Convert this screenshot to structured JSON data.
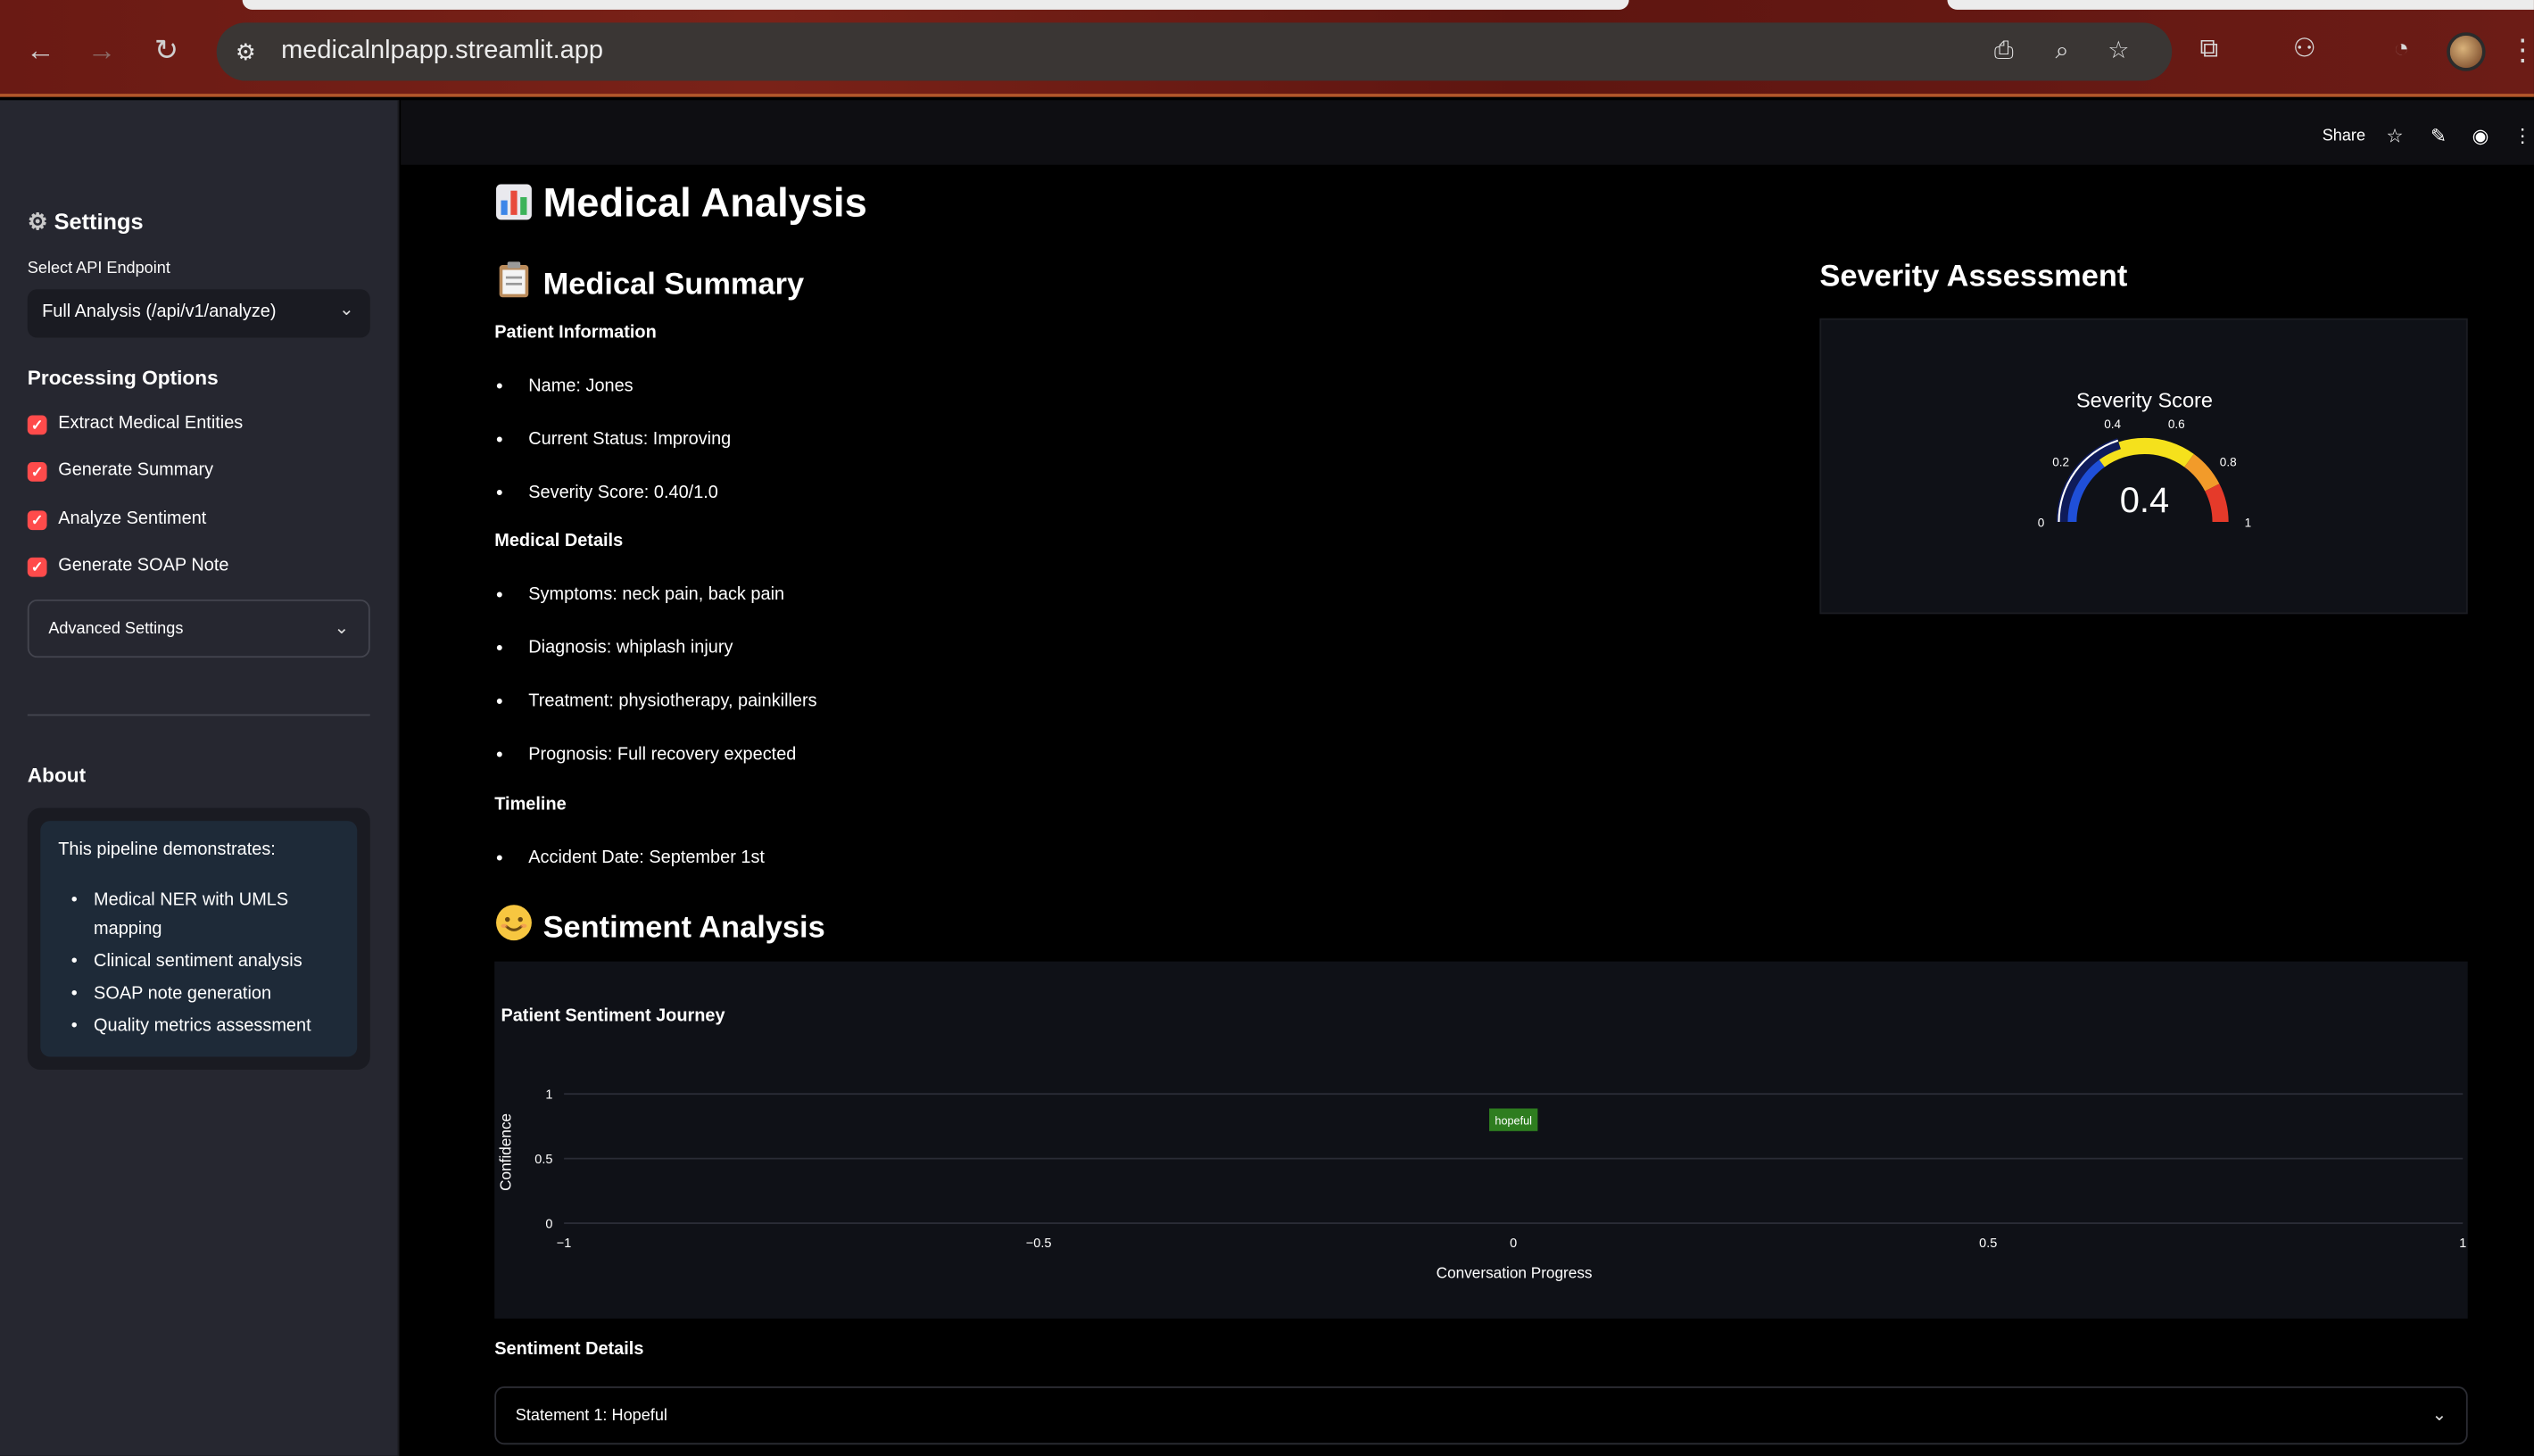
{
  "browser": {
    "url": "medicalnlpapp.streamlit.app"
  },
  "toolbar": {
    "share_label": "Share"
  },
  "sidebar": {
    "settings_title": "Settings",
    "endpoint_label": "Select API Endpoint",
    "endpoint_value": "Full Analysis (/api/v1/analyze)",
    "processing_title": "Processing Options",
    "options": [
      {
        "label": "Extract Medical Entities",
        "checked": true
      },
      {
        "label": "Generate Summary",
        "checked": true
      },
      {
        "label": "Analyze Sentiment",
        "checked": true
      },
      {
        "label": "Generate SOAP Note",
        "checked": true
      }
    ],
    "advanced_label": "Advanced Settings",
    "about_title": "About",
    "about_intro": "This pipeline demonstrates:",
    "about_items": [
      "Medical NER with UMLS mapping",
      "Clinical sentiment analysis",
      "SOAP note generation",
      "Quality metrics assessment"
    ]
  },
  "main": {
    "title": "Medical Analysis",
    "summary_title": "Medical Summary",
    "patient_info_title": "Patient Information",
    "patient_info": [
      "Name: Jones",
      "Current Status: Improving",
      "Severity Score: 0.40/1.0"
    ],
    "medical_details_title": "Medical Details",
    "medical_details": [
      "Symptoms: neck pain, back pain",
      "Diagnosis: whiplash injury",
      "Treatment: physiotherapy, painkillers",
      "Prognosis: Full recovery expected"
    ],
    "timeline_title": "Timeline",
    "timeline": [
      "Accident Date: September 1st"
    ],
    "severity_title": "Severity Assessment",
    "sentiment_title": "Sentiment Analysis",
    "sentiment_details_title": "Sentiment Details",
    "statement_label": "Statement 1: Hopeful"
  },
  "chart_data": [
    {
      "type": "gauge",
      "title": "Severity Score",
      "value": 0.4,
      "value_label": "0.4",
      "range": [
        0,
        1
      ],
      "ticks": [
        "0",
        "0.2",
        "0.4",
        "0.6",
        "0.8",
        "1"
      ],
      "bands": [
        {
          "from": 0,
          "to": 0.3,
          "color": "#1f4fd8"
        },
        {
          "from": 0.3,
          "to": 0.7,
          "color": "#f5e11c"
        },
        {
          "from": 0.7,
          "to": 0.85,
          "color": "#f29b2a"
        },
        {
          "from": 0.85,
          "to": 1,
          "color": "#e53a2a"
        }
      ]
    },
    {
      "type": "scatter",
      "title": "Patient Sentiment Journey",
      "xlabel": "Conversation Progress",
      "ylabel": "Confidence",
      "xlim": [
        -1,
        1
      ],
      "ylim": [
        0,
        1
      ],
      "x_ticks": [
        "−1",
        "−0.5",
        "0",
        "0.5",
        "1"
      ],
      "y_ticks": [
        "0",
        "0.5",
        "1"
      ],
      "points": [
        {
          "x": 0,
          "y": 0.8,
          "label": "hopeful",
          "color": "#2e7d1f"
        }
      ]
    }
  ]
}
